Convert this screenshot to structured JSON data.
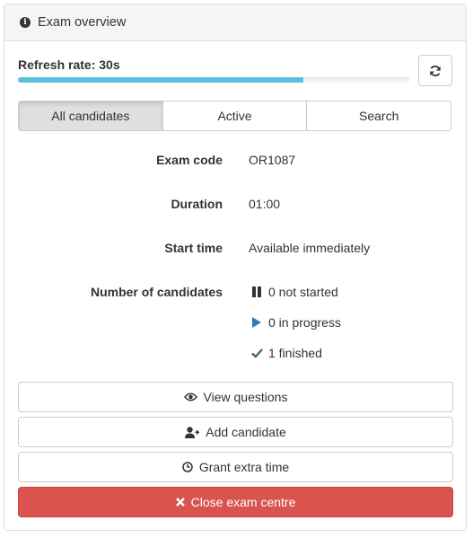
{
  "panel": {
    "title": "Exam overview",
    "icon": "info-circle-icon"
  },
  "refresh": {
    "label": "Refresh rate: 30s",
    "progress_fraction": 0.73,
    "button_icon": "refresh-icon"
  },
  "tabs": [
    {
      "label": "All candidates",
      "active": true
    },
    {
      "label": "Active",
      "active": false
    },
    {
      "label": "Search",
      "active": false
    }
  ],
  "details": {
    "exam_code": {
      "label": "Exam code",
      "value": "OR1087"
    },
    "duration": {
      "label": "Duration",
      "value": "01:00"
    },
    "start_time": {
      "label": "Start time",
      "value": "Available immediately"
    },
    "candidates": {
      "label": "Number of candidates",
      "not_started": "0 not started",
      "in_progress": "0 in progress",
      "finished": "1 finished"
    }
  },
  "buttons": {
    "view_questions": "View questions",
    "add_candidate": "Add candidate",
    "grant_extra_time": "Grant extra time",
    "close_exam_centre": "Close exam centre"
  },
  "colors": {
    "progress": "#5bc0de",
    "danger": "#d9534f",
    "play": "#337ab7",
    "check": "#3c763d"
  }
}
